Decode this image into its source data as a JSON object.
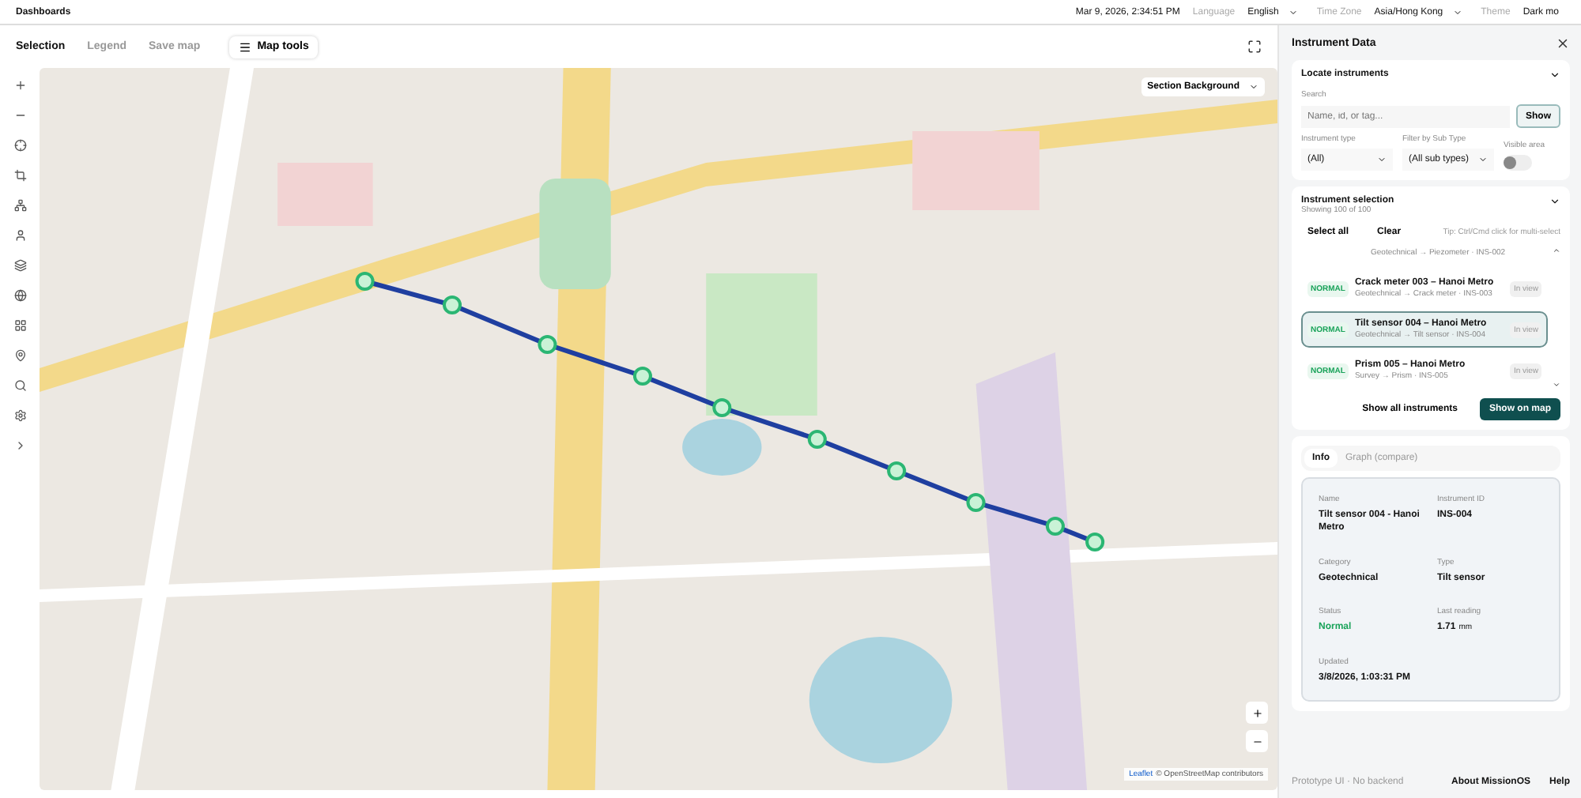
{
  "top_bar": {
    "title": "Dashboards",
    "datetime": "Mar 9, 2026, 2:34:51 PM",
    "settings": [
      {
        "label": "Language",
        "value": "English",
        "kind": "select"
      },
      {
        "label": "Time Zone",
        "value": "Asia/Hong Kong",
        "kind": "select"
      },
      {
        "label": "Theme",
        "value": "Dark mo",
        "kind": "clipped"
      }
    ]
  },
  "map_toolbar": {
    "tabs": [
      {
        "label": "Selection",
        "selected": true
      },
      {
        "label": "Legend",
        "selected": false
      },
      {
        "label": "Save map",
        "selected": false
      }
    ],
    "tools_button": "Map tools"
  },
  "map": {
    "layer_select": "Section Background",
    "attribution_link": "Leaflet",
    "attribution_text": "© OpenStreetMap contributors"
  },
  "panel": {
    "title": "Instrument Data",
    "locate": {
      "title": "Locate instruments",
      "expanded": true,
      "search_label": "Search",
      "search_placeholder": "Name, id, or tag...",
      "show_button": "Show",
      "type_label": "Instrument type",
      "type_value": "(All)",
      "subtype_label": "Filter by Sub Type",
      "subtype_value": "(All sub types)",
      "visible_area_label": "Visible area",
      "visible_area_on": false
    },
    "selection": {
      "title": "Instrument selection",
      "expanded": true,
      "count": "Showing 100 of 100",
      "select_all": "Select all",
      "clear": "Clear",
      "tip": "Tip: Ctrl/Cmd click for multi-select",
      "items": [
        {
          "kind": "clipped",
          "subtitle": "Geotechnical → Piezometer · INS-002",
          "selected": false
        },
        {
          "kind": "full",
          "status": "NORMAL",
          "title": "Crack meter 003 – Hanoi Metro",
          "subtitle": "Geotechnical → Crack meter · INS-003",
          "tag": "In view",
          "selected": false
        },
        {
          "kind": "full",
          "status": "NORMAL",
          "title": "Tilt sensor 004 – Hanoi Metro",
          "subtitle": "Geotechnical → Tilt sensor · INS-004",
          "tag": "In view",
          "selected": true
        },
        {
          "kind": "full",
          "status": "NORMAL",
          "title": "Prism 005 – Hanoi Metro",
          "subtitle": "Survey → Prism · INS-005",
          "tag": "In view",
          "selected": false
        }
      ],
      "show_all": "Show all instruments",
      "show_on_map": "Show on map"
    },
    "detail_tabs": [
      {
        "label": "Info",
        "selected": true
      },
      {
        "label": "Graph (compare)",
        "selected": false
      }
    ],
    "details": [
      {
        "label": "Name",
        "value": "Tilt sensor 004 - Hanoi Metro",
        "kind": "text"
      },
      {
        "label": "Instrument ID",
        "value": "INS-004",
        "kind": "text"
      },
      {
        "label": "Category",
        "value": "Geotechnical",
        "kind": "text"
      },
      {
        "label": "Type",
        "value": "Tilt sensor",
        "kind": "text"
      },
      {
        "label": "Status",
        "value": "Normal",
        "kind": "status"
      },
      {
        "label": "Last reading",
        "value": "1.71",
        "unit": "mm",
        "kind": "reading"
      },
      {
        "label": "Updated",
        "value": "3/8/2026, 1:03:31 PM",
        "kind": "text"
      }
    ]
  },
  "footer": {
    "note": "Prototype UI · No backend",
    "links": [
      "About MissionOS",
      "Help"
    ]
  }
}
